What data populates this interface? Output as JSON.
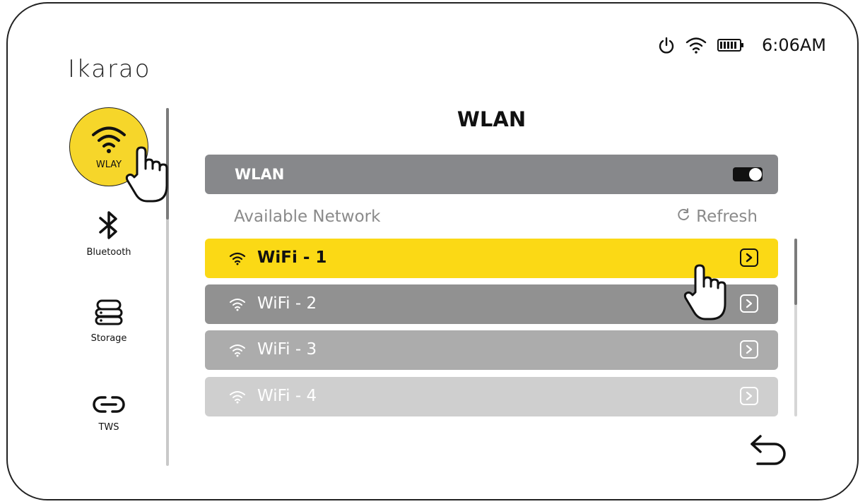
{
  "app": {
    "brand": "Ikarao"
  },
  "status_bar": {
    "icons": [
      "power-icon",
      "wifi-icon",
      "battery-icon"
    ],
    "time": "6:06AM"
  },
  "sidebar": {
    "items": [
      {
        "label": "WLAY",
        "icon": "wifi-icon",
        "selected": true
      },
      {
        "label": "Bluetooth",
        "icon": "bluetooth-icon"
      },
      {
        "label": "Storage",
        "icon": "storage-icon"
      },
      {
        "label": "TWS",
        "icon": "link-icon"
      }
    ]
  },
  "main": {
    "title": "WLAN",
    "wlan_toggle": {
      "label": "WLAN",
      "on": true
    },
    "available_label": "Available Network",
    "refresh_label": "Refresh",
    "networks": [
      {
        "name": "WiFi - 1",
        "selected": true
      },
      {
        "name": "WiFi - 2"
      },
      {
        "name": "WiFi - 3"
      },
      {
        "name": "WiFi - 4"
      }
    ]
  },
  "colors": {
    "accent": "#fbd915",
    "nav_selected": "#f6d62a",
    "bar_gray": "#87888b"
  }
}
